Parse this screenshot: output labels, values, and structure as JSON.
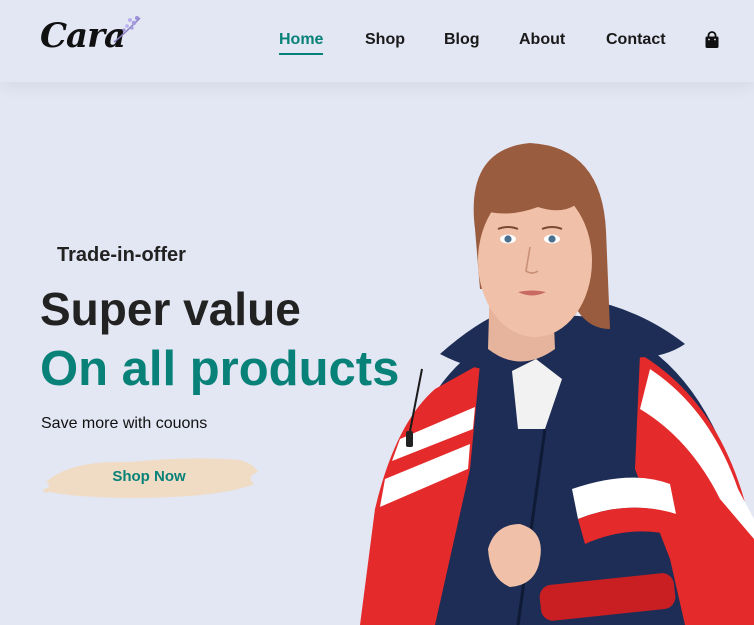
{
  "brand": {
    "name": "Cara"
  },
  "nav": {
    "items": [
      {
        "label": "Home",
        "active": true
      },
      {
        "label": "Shop",
        "active": false
      },
      {
        "label": "Blog",
        "active": false
      },
      {
        "label": "About",
        "active": false
      },
      {
        "label": "Contact",
        "active": false
      }
    ],
    "cart_icon": "shopping-bag-icon"
  },
  "hero": {
    "offer": "Trade-in-offer",
    "headline": "Super value",
    "subheadline": "On all products",
    "tagline": "Save more with couons",
    "button_label": "Shop Now"
  },
  "colors": {
    "background": "#e3e6f3",
    "accent": "#088178",
    "text": "#222222",
    "button_brush": "#f0dcc4",
    "jacket_navy": "#1d2d55",
    "jacket_red": "#e42a2a"
  }
}
